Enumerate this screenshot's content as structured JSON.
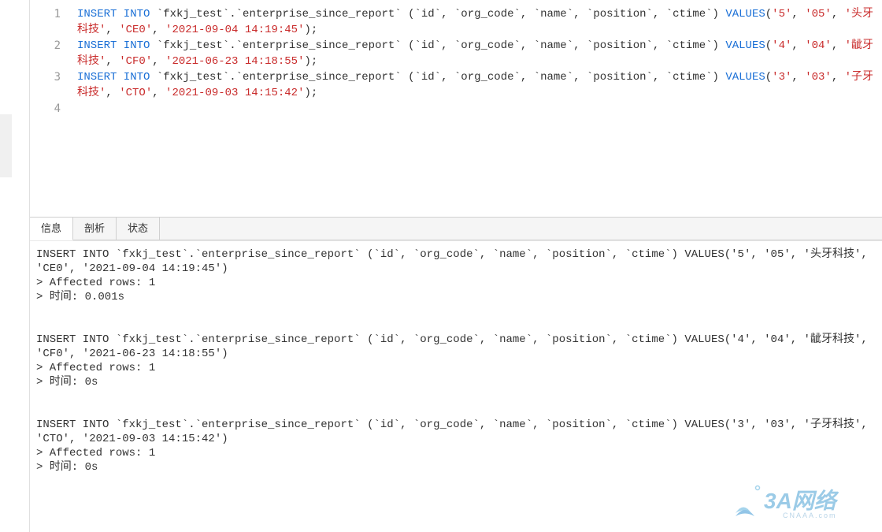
{
  "editor": {
    "lines": [
      {
        "num": "1"
      },
      {
        "num": "2"
      },
      {
        "num": "3"
      },
      {
        "num": "4"
      }
    ],
    "sql": [
      {
        "kw1": "INSERT INTO",
        "tbl": " `fxkj_test`.`enterprise_since_report` (`id`, `org_code`, `name`, `position`, `ctime`) ",
        "kw2": "VALUES",
        "open": "(",
        "vals": [
          "'5'",
          "'05'",
          "'头牙科技'",
          "'CE0'",
          "'2021-09-04 14:19:45'"
        ],
        "close": ");"
      },
      {
        "kw1": "INSERT INTO",
        "tbl": " `fxkj_test`.`enterprise_since_report` (`id`, `org_code`, `name`, `position`, `ctime`) ",
        "kw2": "VALUES",
        "open": "(",
        "vals": [
          "'4'",
          "'04'",
          "'龇牙科技'",
          "'CF0'",
          "'2021-06-23 14:18:55'"
        ],
        "close": ");"
      },
      {
        "kw1": "INSERT INTO",
        "tbl": " `fxkj_test`.`enterprise_since_report` (`id`, `org_code`, `name`, `position`, `ctime`) ",
        "kw2": "VALUES",
        "open": "(",
        "vals": [
          "'3'",
          "'03'",
          "'子牙科技'",
          "'CTO'",
          "'2021-09-03 14:15:42'"
        ],
        "close": ");"
      }
    ]
  },
  "tabs": {
    "info": "信息",
    "profile": "剖析",
    "status": "状态"
  },
  "output": {
    "blocks": [
      {
        "stmt": "INSERT INTO `fxkj_test`.`enterprise_since_report` (`id`, `org_code`, `name`, `position`, `ctime`) VALUES('5', '05', '头牙科技', 'CE0', '2021-09-04 14:19:45')",
        "affected": "> Affected rows: 1",
        "time": "> 时间: 0.001s"
      },
      {
        "stmt": "INSERT INTO `fxkj_test`.`enterprise_since_report` (`id`, `org_code`, `name`, `position`, `ctime`) VALUES('4', '04', '龇牙科技', 'CF0', '2021-06-23 14:18:55')",
        "affected": "> Affected rows: 1",
        "time": "> 时间: 0s"
      },
      {
        "stmt": "INSERT INTO `fxkj_test`.`enterprise_since_report` (`id`, `org_code`, `name`, `position`, `ctime`) VALUES('3', '03', '子牙科技', 'CTO', '2021-09-03 14:15:42')",
        "affected": "> Affected rows: 1",
        "time": "> 时间: 0s"
      }
    ]
  },
  "watermark": {
    "brand": "3A网络",
    "sub": "CNAAA.com"
  }
}
